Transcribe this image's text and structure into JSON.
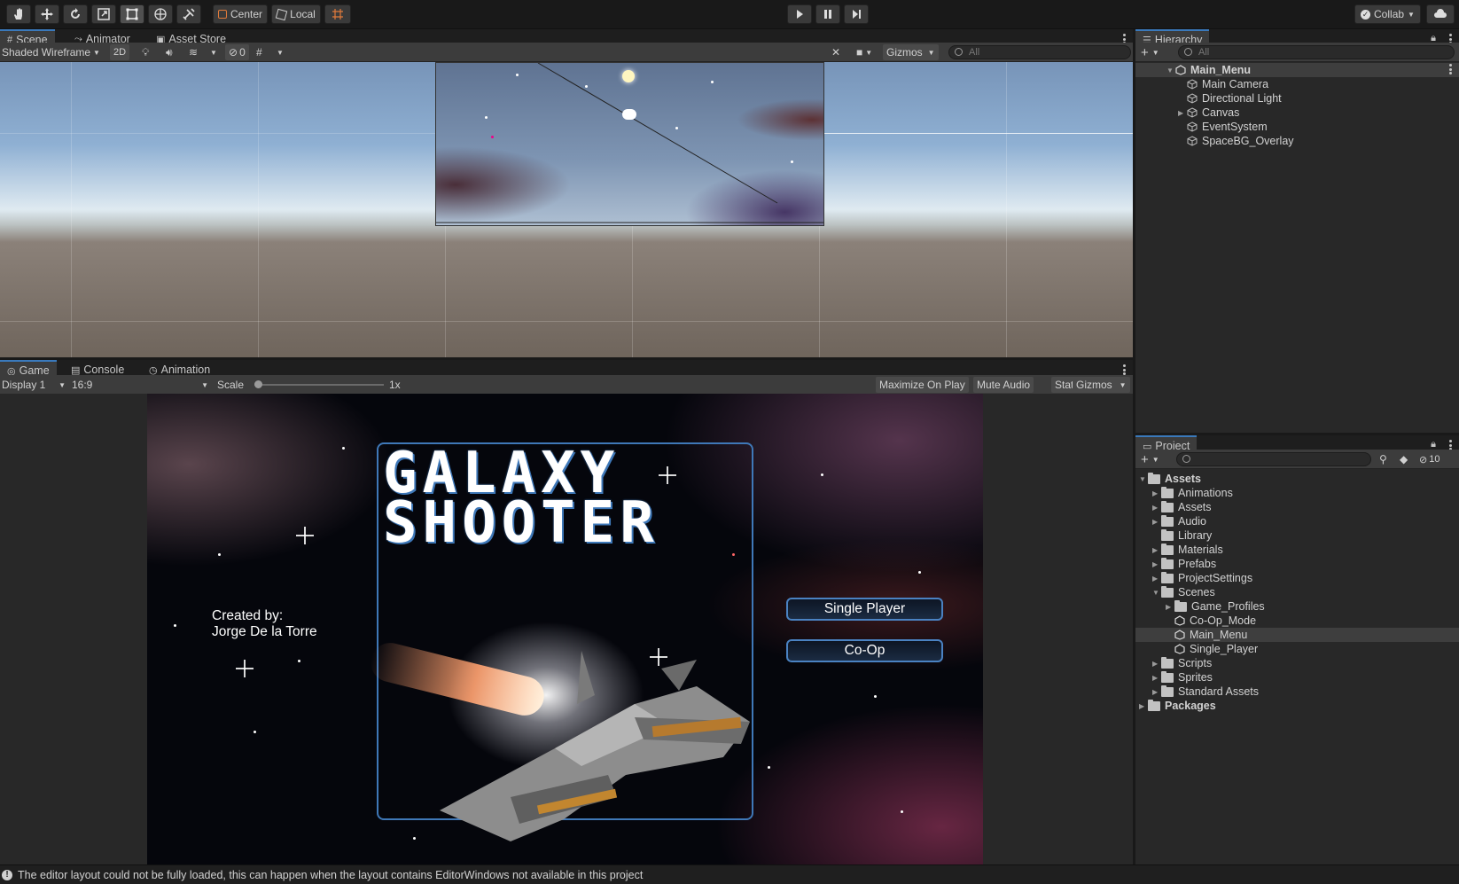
{
  "toolbar": {
    "pivot_label": "Center",
    "space_label": "Local",
    "collab_label": "Collab"
  },
  "scene_panel": {
    "tabs": [
      {
        "label": "Scene"
      },
      {
        "label": "Animator"
      },
      {
        "label": "Asset Store"
      }
    ],
    "draw_mode": "Shaded Wireframe",
    "mode_2d": "2D",
    "hidden_count": "0",
    "gizmos_label": "Gizmos",
    "search_placeholder": "All"
  },
  "game_panel": {
    "tabs": [
      {
        "label": "Game"
      },
      {
        "label": "Console"
      },
      {
        "label": "Animation"
      }
    ],
    "display": "Display 1",
    "aspect": "16:9",
    "scale_label": "Scale",
    "scale_value": "1x",
    "maximize_label": "Maximize On Play",
    "mute_label": "Mute Audio",
    "stats_label": "Stats",
    "gizmos_label": "Gizmos",
    "scale_fraction": 0.0
  },
  "game": {
    "title_line1": "GALAXY",
    "title_line2": "SHOOTER",
    "credit_line1": "Created by:",
    "credit_line2": "Jorge De la Torre",
    "single_player_label": "Single Player",
    "coop_label": "Co-Op"
  },
  "hierarchy": {
    "tab_label": "Hierarchy",
    "search_placeholder": "All",
    "scene_name": "Main_Menu",
    "objects": [
      {
        "label": "Main Camera"
      },
      {
        "label": "Directional Light"
      },
      {
        "label": "Canvas"
      },
      {
        "label": "EventSystem"
      },
      {
        "label": "SpaceBG_Overlay"
      }
    ]
  },
  "project": {
    "tab_label": "Project",
    "hidden_count": "10",
    "root_label": "Assets",
    "folders": [
      {
        "label": "Animations"
      },
      {
        "label": "Assets"
      },
      {
        "label": "Audio"
      },
      {
        "label": "Library"
      },
      {
        "label": "Materials"
      },
      {
        "label": "Prefabs"
      },
      {
        "label": "ProjectSettings"
      },
      {
        "label": "Scenes"
      }
    ],
    "scene_children": [
      {
        "label": "Game_Profiles"
      },
      {
        "label": "Co-Op_Mode"
      },
      {
        "label": "Main_Menu"
      },
      {
        "label": "Single_Player"
      }
    ],
    "more_folders": [
      {
        "label": "Scripts"
      },
      {
        "label": "Sprites"
      },
      {
        "label": "Standard Assets"
      }
    ],
    "packages_label": "Packages"
  },
  "status": {
    "message": "The editor layout could not be fully loaded, this can happen when the layout contains EditorWindows not available in this project"
  },
  "colors": {
    "accent": "#3a79bb",
    "panel": "#282828",
    "toolbar": "#191919"
  }
}
